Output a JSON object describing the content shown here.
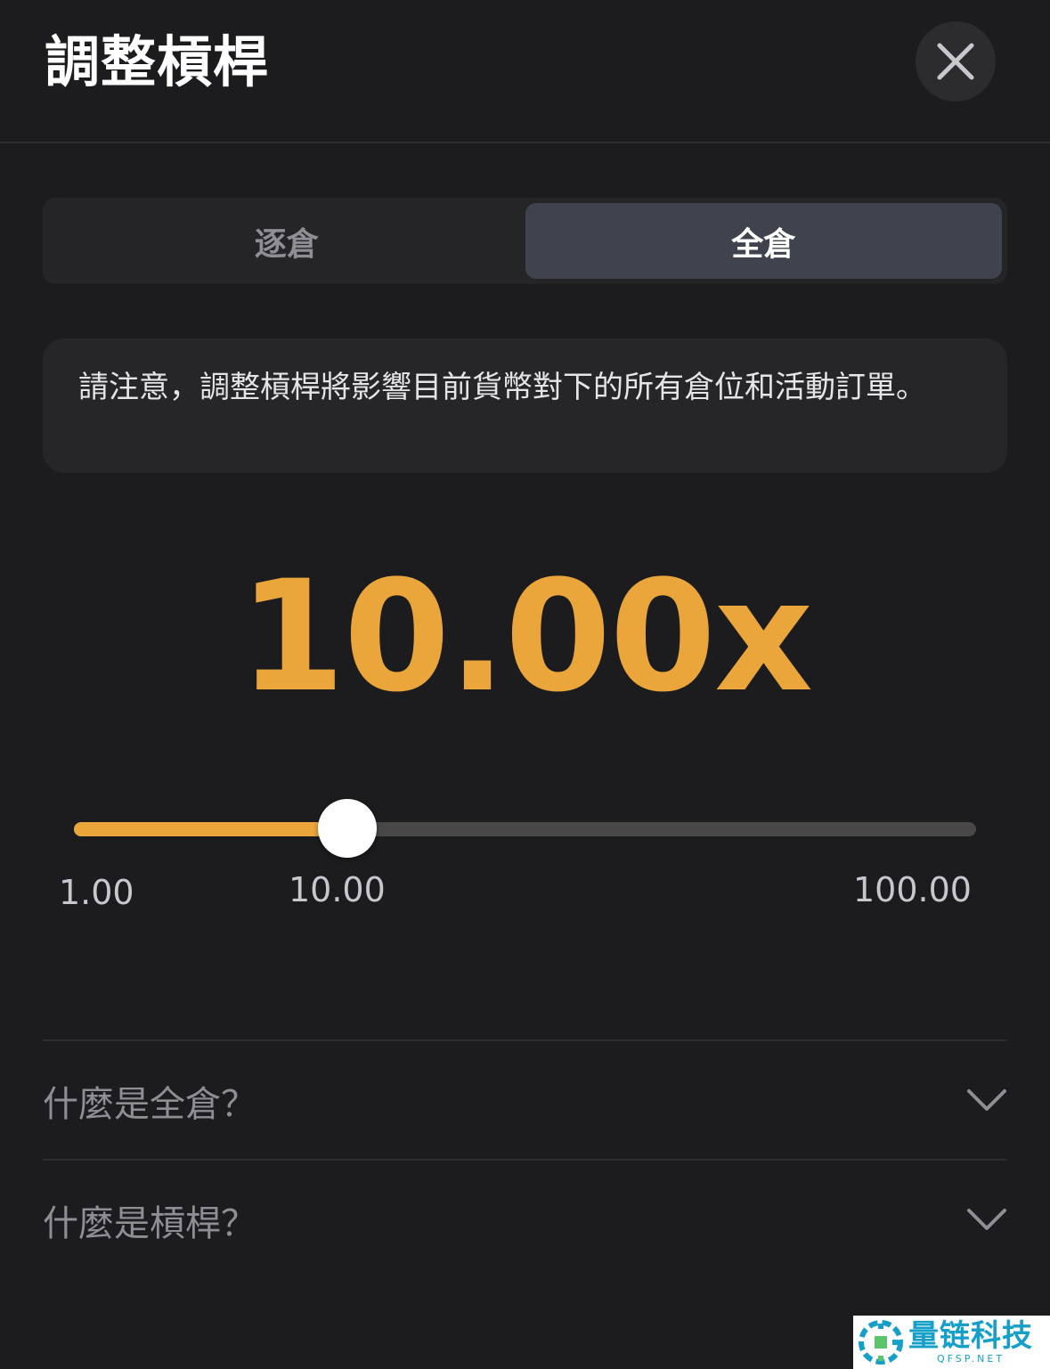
{
  "header": {
    "title": "調整槓桿",
    "close_icon": "close-icon"
  },
  "margin_mode": {
    "tabs": [
      {
        "label": "逐倉",
        "active": false
      },
      {
        "label": "全倉",
        "active": true
      }
    ]
  },
  "notice": {
    "text": "請注意，調整槓桿將影響目前貨幣對下的所有倉位和活動訂單。"
  },
  "leverage": {
    "display": "10.00x",
    "value": 10,
    "min": 1,
    "max": 100
  },
  "slider": {
    "min_label": "1.00",
    "current_label": "10.00",
    "max_label": "100.00",
    "fill_fraction": 0.303
  },
  "faq": [
    {
      "question": "什麼是全倉？",
      "icon": "chevron-down-icon"
    },
    {
      "question": "什麼是槓桿？",
      "icon": "chevron-down-icon"
    }
  ],
  "watermark": {
    "name": "量链科技",
    "sub": "QFSP.NET"
  },
  "colors": {
    "background": "#1c1c1e",
    "accent": "#eaa63a",
    "segment_active": "#3f434e",
    "track": "#4a4749",
    "watermark": "#16a0c8"
  }
}
